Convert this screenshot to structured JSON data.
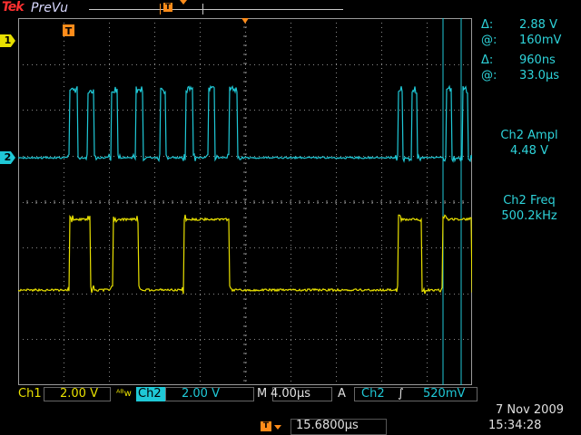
{
  "header": {
    "brand": "Tek",
    "mode": "PreVu"
  },
  "markers": {
    "ch1": "1",
    "ch2": "2",
    "trigger": "T"
  },
  "colors": {
    "ch1": "#e8e000",
    "ch2": "#1fc8d6",
    "trigger": "#ff8c1a",
    "grid": "#8a8a8a",
    "cursor": "#1fc8d6"
  },
  "cursors": {
    "amplitude": {
      "delta_symbol": "Δ:",
      "delta_value": "2.88 V",
      "at_symbol": "@:",
      "at_value": "160mV"
    },
    "time": {
      "delta_symbol": "Δ:",
      "delta_value": "960ns",
      "at_symbol": "@:",
      "at_value": "33.0µs"
    }
  },
  "measurements": [
    {
      "label": "Ch2 Ampl",
      "value": "4.48 V"
    },
    {
      "label": "Ch2 Freq",
      "value": "500.2kHz"
    }
  ],
  "status": {
    "ch1_label": "Ch1",
    "ch1_scale": "2.00 V",
    "bw_symbol": "ᴬᴮw",
    "ch2_label": "Ch2",
    "ch2_scale": "2.00 V",
    "timebase_label": "M",
    "timebase": "4.00µs",
    "trigger_mode": "A",
    "trigger_source": "Ch2",
    "trigger_slope": "∫",
    "trigger_level": "520mV",
    "trigger_position": "15.6800µs",
    "date": "7 Nov 2009",
    "time": "15:34:28"
  },
  "icons": {
    "trigger_slope": "rising-edge-icon",
    "trigger_position": "trigger-position-icon"
  }
}
